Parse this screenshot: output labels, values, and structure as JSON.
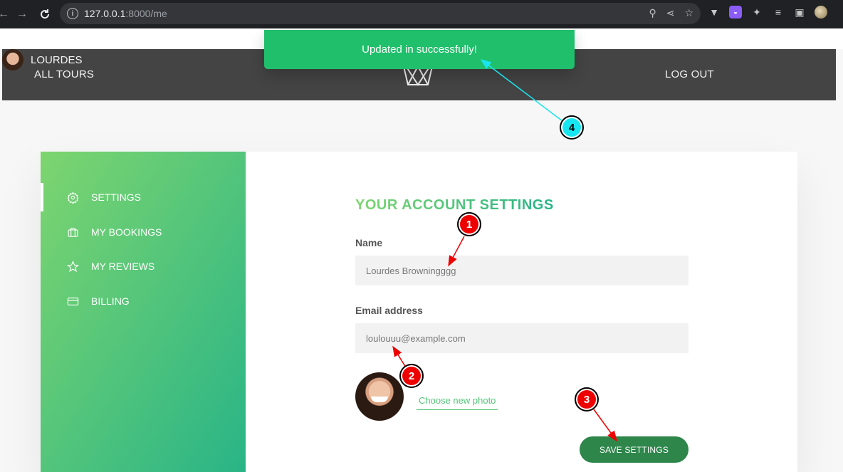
{
  "browser": {
    "url_host": "127.0.0.1",
    "url_path": ":8000/me"
  },
  "header": {
    "all_tours": "ALL TOURS",
    "log_out": "LOG OUT",
    "user_name": "LOURDES"
  },
  "alert": {
    "message": "Updated in successfully!"
  },
  "sidebar": {
    "items": [
      {
        "label": "SETTINGS",
        "icon": "gear-icon"
      },
      {
        "label": "MY BOOKINGS",
        "icon": "briefcase-icon"
      },
      {
        "label": "MY REVIEWS",
        "icon": "star-icon"
      },
      {
        "label": "BILLING",
        "icon": "credit-card-icon"
      }
    ]
  },
  "account": {
    "heading": "YOUR ACCOUNT SETTINGS",
    "name_label": "Name",
    "name_value": "Lourdes Browningggg",
    "email_label": "Email address",
    "email_value": "loulouuu@example.com",
    "choose_photo": "Choose new photo",
    "save_label": "SAVE SETTINGS"
  },
  "annotations": {
    "badges": [
      "1",
      "2",
      "3",
      "4"
    ],
    "colors": {
      "red": "#ee0000",
      "cyan": "#17e6f0"
    }
  },
  "colors": {
    "primary_green": "#55c57a",
    "alert_green": "#20bf6b",
    "header_bg": "#444444",
    "save_button": "#2e864b"
  }
}
